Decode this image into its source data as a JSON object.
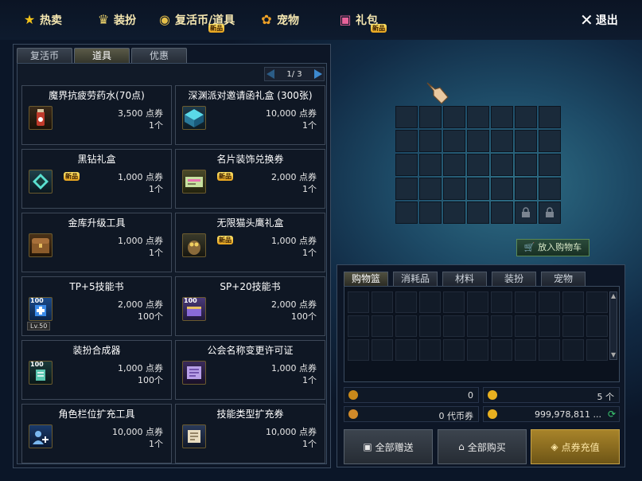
{
  "menu": {
    "hot": "热卖",
    "outfit": "装扮",
    "revive": "复活币/道具",
    "pet": "宠物",
    "gift": "礼包",
    "exit": "退出",
    "new_badge": "新品"
  },
  "left_tabs": [
    "复活币",
    "道具",
    "优惠"
  ],
  "pager": "1/ 3",
  "items": [
    {
      "name": "魔界抗疲劳药水(70点)",
      "price": "3,500 点券",
      "qty": "1个",
      "new": ""
    },
    {
      "name": "深渊派对邀请函礼盒 (300张)",
      "price": "10,000 点券",
      "qty": "1个",
      "new": ""
    },
    {
      "name": "黑钻礼盒",
      "price": "1,000 点券",
      "qty": "1个",
      "new": "新品"
    },
    {
      "name": "名片装饰兑换券",
      "price": "2,000 点券",
      "qty": "1个",
      "new": "新品"
    },
    {
      "name": "金库升级工具",
      "price": "1,000 点券",
      "qty": "1个",
      "new": ""
    },
    {
      "name": "无限猫头鹰礼盒",
      "price": "1,000 点券",
      "qty": "1个",
      "new": "新品"
    },
    {
      "name": "TP+5技能书",
      "price": "2,000 点券",
      "qty": "100个",
      "new": ""
    },
    {
      "name": "SP+20技能书",
      "price": "2,000 点券",
      "qty": "100个",
      "new": ""
    },
    {
      "name": "装扮合成器",
      "price": "1,000 点券",
      "qty": "100个",
      "new": ""
    },
    {
      "name": "公会名称变更许可证",
      "price": "1,000 点券",
      "qty": "1个",
      "new": ""
    },
    {
      "name": "角色栏位扩充工具",
      "price": "10,000 点券",
      "qty": "1个",
      "new": ""
    },
    {
      "name": "技能类型扩充券",
      "price": "10,000 点券",
      "qty": "1个",
      "new": ""
    }
  ],
  "badges": {
    "hundred": "100",
    "lv50": "Lv.50"
  },
  "cart_button": "放入购物车",
  "cart_tabs": [
    "购物篮",
    "消耗品",
    "材料",
    "装扮",
    "宠物"
  ],
  "stats": {
    "left_top": "0",
    "right_top": "5 个",
    "left_bottom": "0 代币券",
    "right_bottom": "999,978,811 ..."
  },
  "bottom_buttons": {
    "gift_all": "全部赠送",
    "buy_all": "全部购买",
    "recharge": "点券充值"
  },
  "colors": {
    "gold": "#f4e6b0",
    "accent_blue": "#3d8ad0"
  }
}
